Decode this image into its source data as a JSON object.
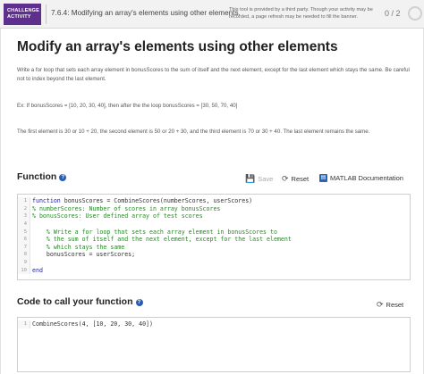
{
  "topbar": {
    "badge_line1": "CHALLENGE",
    "badge_line2": "ACTIVITY",
    "title": "7.6.4: Modifying an array's elements using other elements.",
    "third_party_note": "This tool is provided by a third party. Though your activity may be recorded, a page refresh may be needed to fill the banner.",
    "progress": "0 / 2"
  },
  "page": {
    "title": "Modify an array's elements using other elements",
    "instructions": "Write a for loop that sets each array element in bonusScores to the sum of itself and the next element, except for the last element which stays the same. Be careful not to index beyond the last element.",
    "example": "Ex: If bonusScores = [10, 20, 30, 40], then after the the loop bonusScores = [30, 50, 70, 40]",
    "explanation": "The first element is 30 or 10 + 20, the second element is 50 or 20 + 30, and the third element is 70 or 30 + 40. The last element remains the same."
  },
  "function_section": {
    "title": "Function",
    "help_icon": "?",
    "save_label": "Save",
    "reset_label": "Reset",
    "doc_label": "MATLAB Documentation",
    "lines": [
      {
        "num": "1",
        "kw": "function",
        "text": " bonusScores = CombineScores(numberScores, userScores)",
        "comment": ""
      },
      {
        "num": "2",
        "kw": "",
        "text": "",
        "comment": "% numberScores: Number of scores in array bonusScores"
      },
      {
        "num": "3",
        "kw": "",
        "text": "",
        "comment": "% bonusScores: User defined array of test scores"
      },
      {
        "num": "4",
        "kw": "",
        "text": "",
        "comment": ""
      },
      {
        "num": "5",
        "kw": "",
        "text": "    ",
        "comment": "% Write a for loop that sets each array element in bonusScores to"
      },
      {
        "num": "6",
        "kw": "",
        "text": "    ",
        "comment": "% the sum of itself and the next element, except for the last element"
      },
      {
        "num": "7",
        "kw": "",
        "text": "    ",
        "comment": "% which stays the same"
      },
      {
        "num": "8",
        "kw": "",
        "text": "    bonusScores = userScores;",
        "comment": ""
      },
      {
        "num": "9",
        "kw": "",
        "text": "",
        "comment": ""
      },
      {
        "num": "10",
        "kw": "end",
        "text": "",
        "comment": ""
      }
    ]
  },
  "call_section": {
    "title": "Code to call your function",
    "help_icon": "?",
    "reset_label": "Reset",
    "lines": [
      {
        "num": "1",
        "text": "CombineScores(4, [10, 20, 30, 40])"
      }
    ]
  },
  "icons": {
    "save": "save-icon",
    "reset": "refresh-icon",
    "doc": "documentation-icon"
  },
  "colors": {
    "badge": "#5e2f8c",
    "link_blue": "#2a5db0",
    "comment_green": "#228b22",
    "keyword_blue": "#1a1aa6"
  }
}
